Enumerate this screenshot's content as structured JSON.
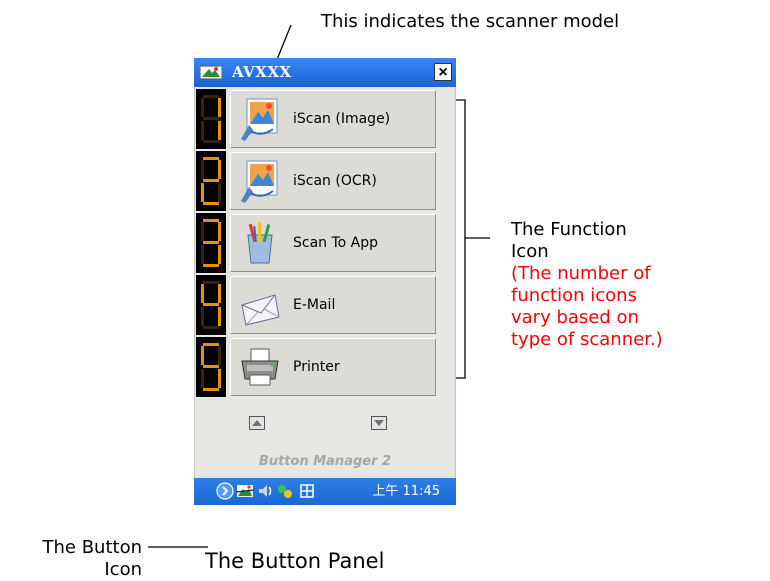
{
  "annotations": {
    "model": "This indicates the scanner model",
    "function_icon_title": "The Function Icon",
    "function_icon_note": "(The number of function icons vary based on type of scanner.)",
    "button_icon": "The Button Icon",
    "panel_caption": "The Button Panel"
  },
  "window": {
    "title": "AVXXX",
    "close_label": "×"
  },
  "buttons": [
    {
      "number": "1",
      "label": "iScan (Image)",
      "icon": "iscan-image-icon"
    },
    {
      "number": "2",
      "label": "iScan (OCR)",
      "icon": "iscan-ocr-icon"
    },
    {
      "number": "3",
      "label": "Scan To App",
      "icon": "scan-to-app-icon"
    },
    {
      "number": "4",
      "label": "E-Mail",
      "icon": "email-icon"
    },
    {
      "number": "5",
      "label": "Printer",
      "icon": "printer-icon"
    }
  ],
  "footer": {
    "brand": "Button Manager 2"
  },
  "taskbar": {
    "clock": "上午 11:45"
  },
  "colors": {
    "note": "#ff0000",
    "digit": "#e8900c",
    "titlebar": "#1a62d8"
  }
}
